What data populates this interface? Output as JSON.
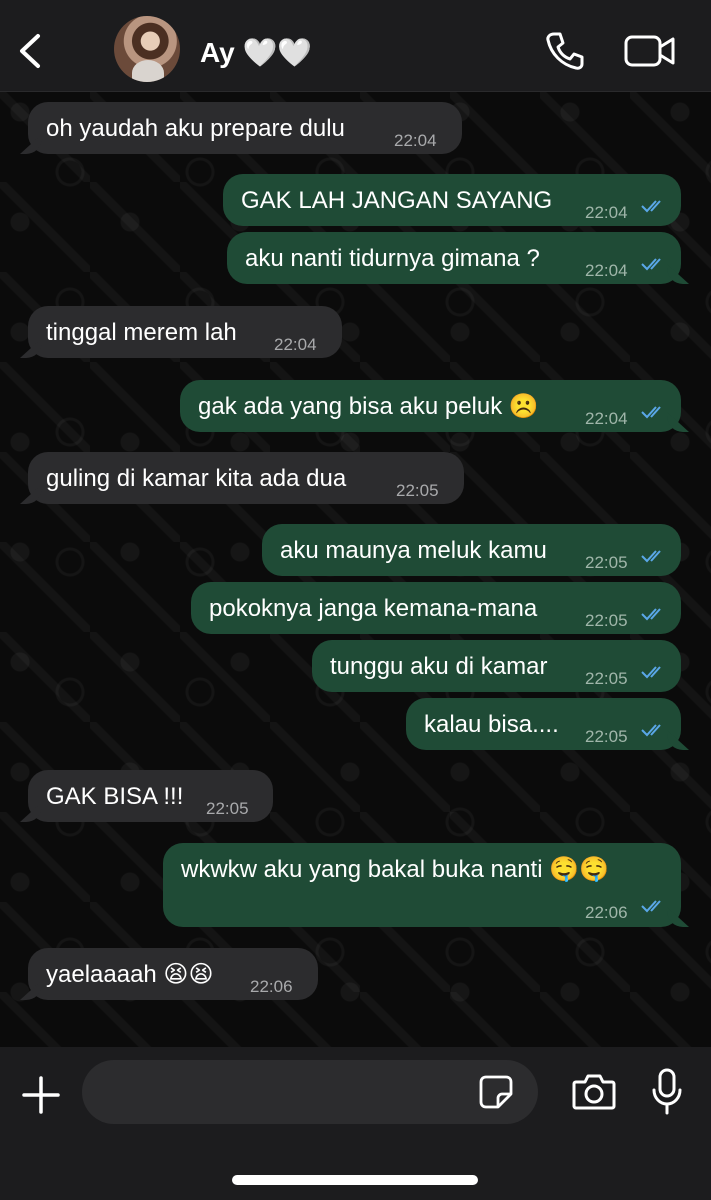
{
  "header": {
    "contact_name": "Ay 🤍🤍",
    "icons": {
      "back": "chevron-left-icon",
      "call": "phone-icon",
      "video": "video-camera-icon"
    }
  },
  "messages": [
    {
      "dir": "in",
      "text": "oh yaudah aku prepare dulu",
      "time": "22:04"
    },
    {
      "dir": "out",
      "text": "GAK LAH JANGAN SAYANG",
      "time": "22:04",
      "status": "read"
    },
    {
      "dir": "out",
      "text": "aku nanti tidurnya gimana ?",
      "time": "22:04",
      "status": "read"
    },
    {
      "dir": "in",
      "text": "tinggal merem lah",
      "time": "22:04"
    },
    {
      "dir": "out",
      "text": "gak ada yang bisa aku peluk ☹️",
      "time": "22:04",
      "status": "read"
    },
    {
      "dir": "in",
      "text": "guling di kamar kita ada dua",
      "time": "22:05"
    },
    {
      "dir": "out",
      "text": "aku maunya meluk kamu",
      "time": "22:05",
      "status": "read"
    },
    {
      "dir": "out",
      "text": "pokoknya janga kemana-mana",
      "time": "22:05",
      "status": "read"
    },
    {
      "dir": "out",
      "text": "tunggu aku di kamar",
      "time": "22:05",
      "status": "read"
    },
    {
      "dir": "out",
      "text": "kalau bisa....",
      "time": "22:05",
      "status": "read"
    },
    {
      "dir": "in",
      "text": "GAK BISA !!!",
      "time": "22:05"
    },
    {
      "dir": "out",
      "text": "wkwkw aku yang bakal buka nanti 🤤🤤",
      "time": "22:06",
      "status": "read"
    },
    {
      "dir": "in",
      "text": "yaelaaaah 😫😫",
      "time": "22:06"
    }
  ],
  "composer": {
    "input_value": "",
    "icons": {
      "plus": "plus-icon",
      "sticker": "sticker-icon",
      "camera": "camera-icon",
      "mic": "microphone-icon"
    }
  },
  "colors": {
    "header_bg": "#1c1c1e",
    "incoming_bubble": "#2c2c2e",
    "outgoing_bubble": "#1f4b36",
    "read_ticks": "#5aa7e8",
    "chat_bg": "#0b0b0b"
  }
}
